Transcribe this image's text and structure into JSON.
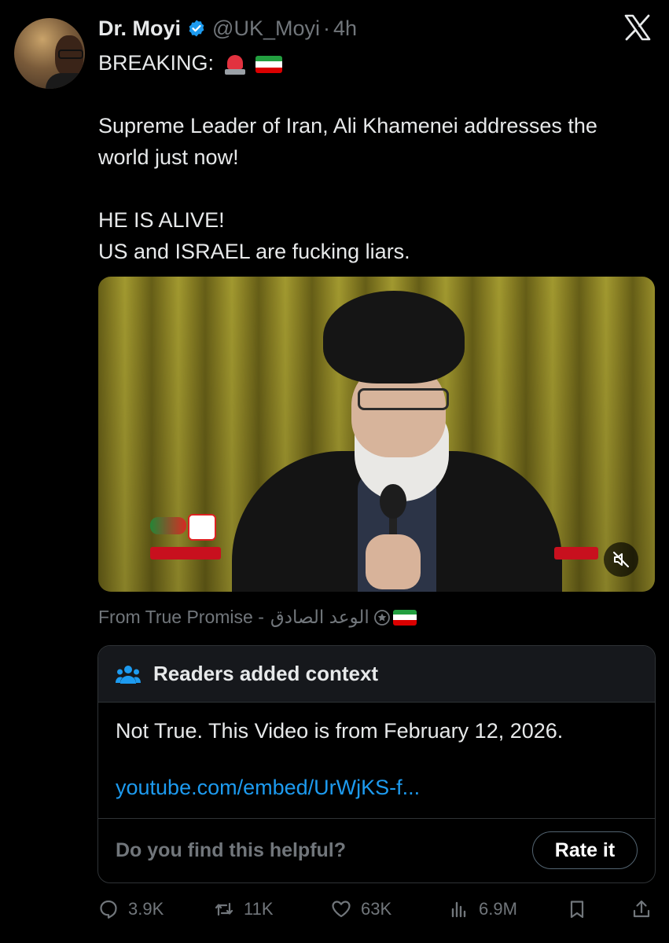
{
  "author": {
    "name": "Dr. Moyi",
    "handle": "@UK_Moyi",
    "separator": "·",
    "time": "4h"
  },
  "tweet": {
    "line1": "BREAKING:",
    "line2": "Supreme Leader of Iran, Ali Khamenei addresses the world just now!",
    "line3": "HE IS ALIVE!",
    "line4": "US and ISRAEL are fucking liars."
  },
  "icons": {
    "verified": "verified-badge-icon",
    "siren": "police-light-emoji",
    "flag": "iran-flag-emoji",
    "mute": "muted-speaker-icon",
    "people": "readers-icon"
  },
  "source": {
    "prefix": "From True Promise - ",
    "arabic": "الوعد الصادق"
  },
  "context": {
    "header": "Readers added context",
    "note": "Not True. This Video is from February 12, 2026.",
    "link": "youtube.com/embed/UrWjKS-f...",
    "question": "Do you find this helpful?",
    "rate_label": "Rate it"
  },
  "actions": {
    "replies": "3.9K",
    "reposts": "11K",
    "likes": "63K",
    "views": "6.9M"
  },
  "colors": {
    "background": "#000000",
    "text": "#e7e9ea",
    "muted": "#71767b",
    "link": "#1d9bf0",
    "verified": "#1d9bf0"
  }
}
